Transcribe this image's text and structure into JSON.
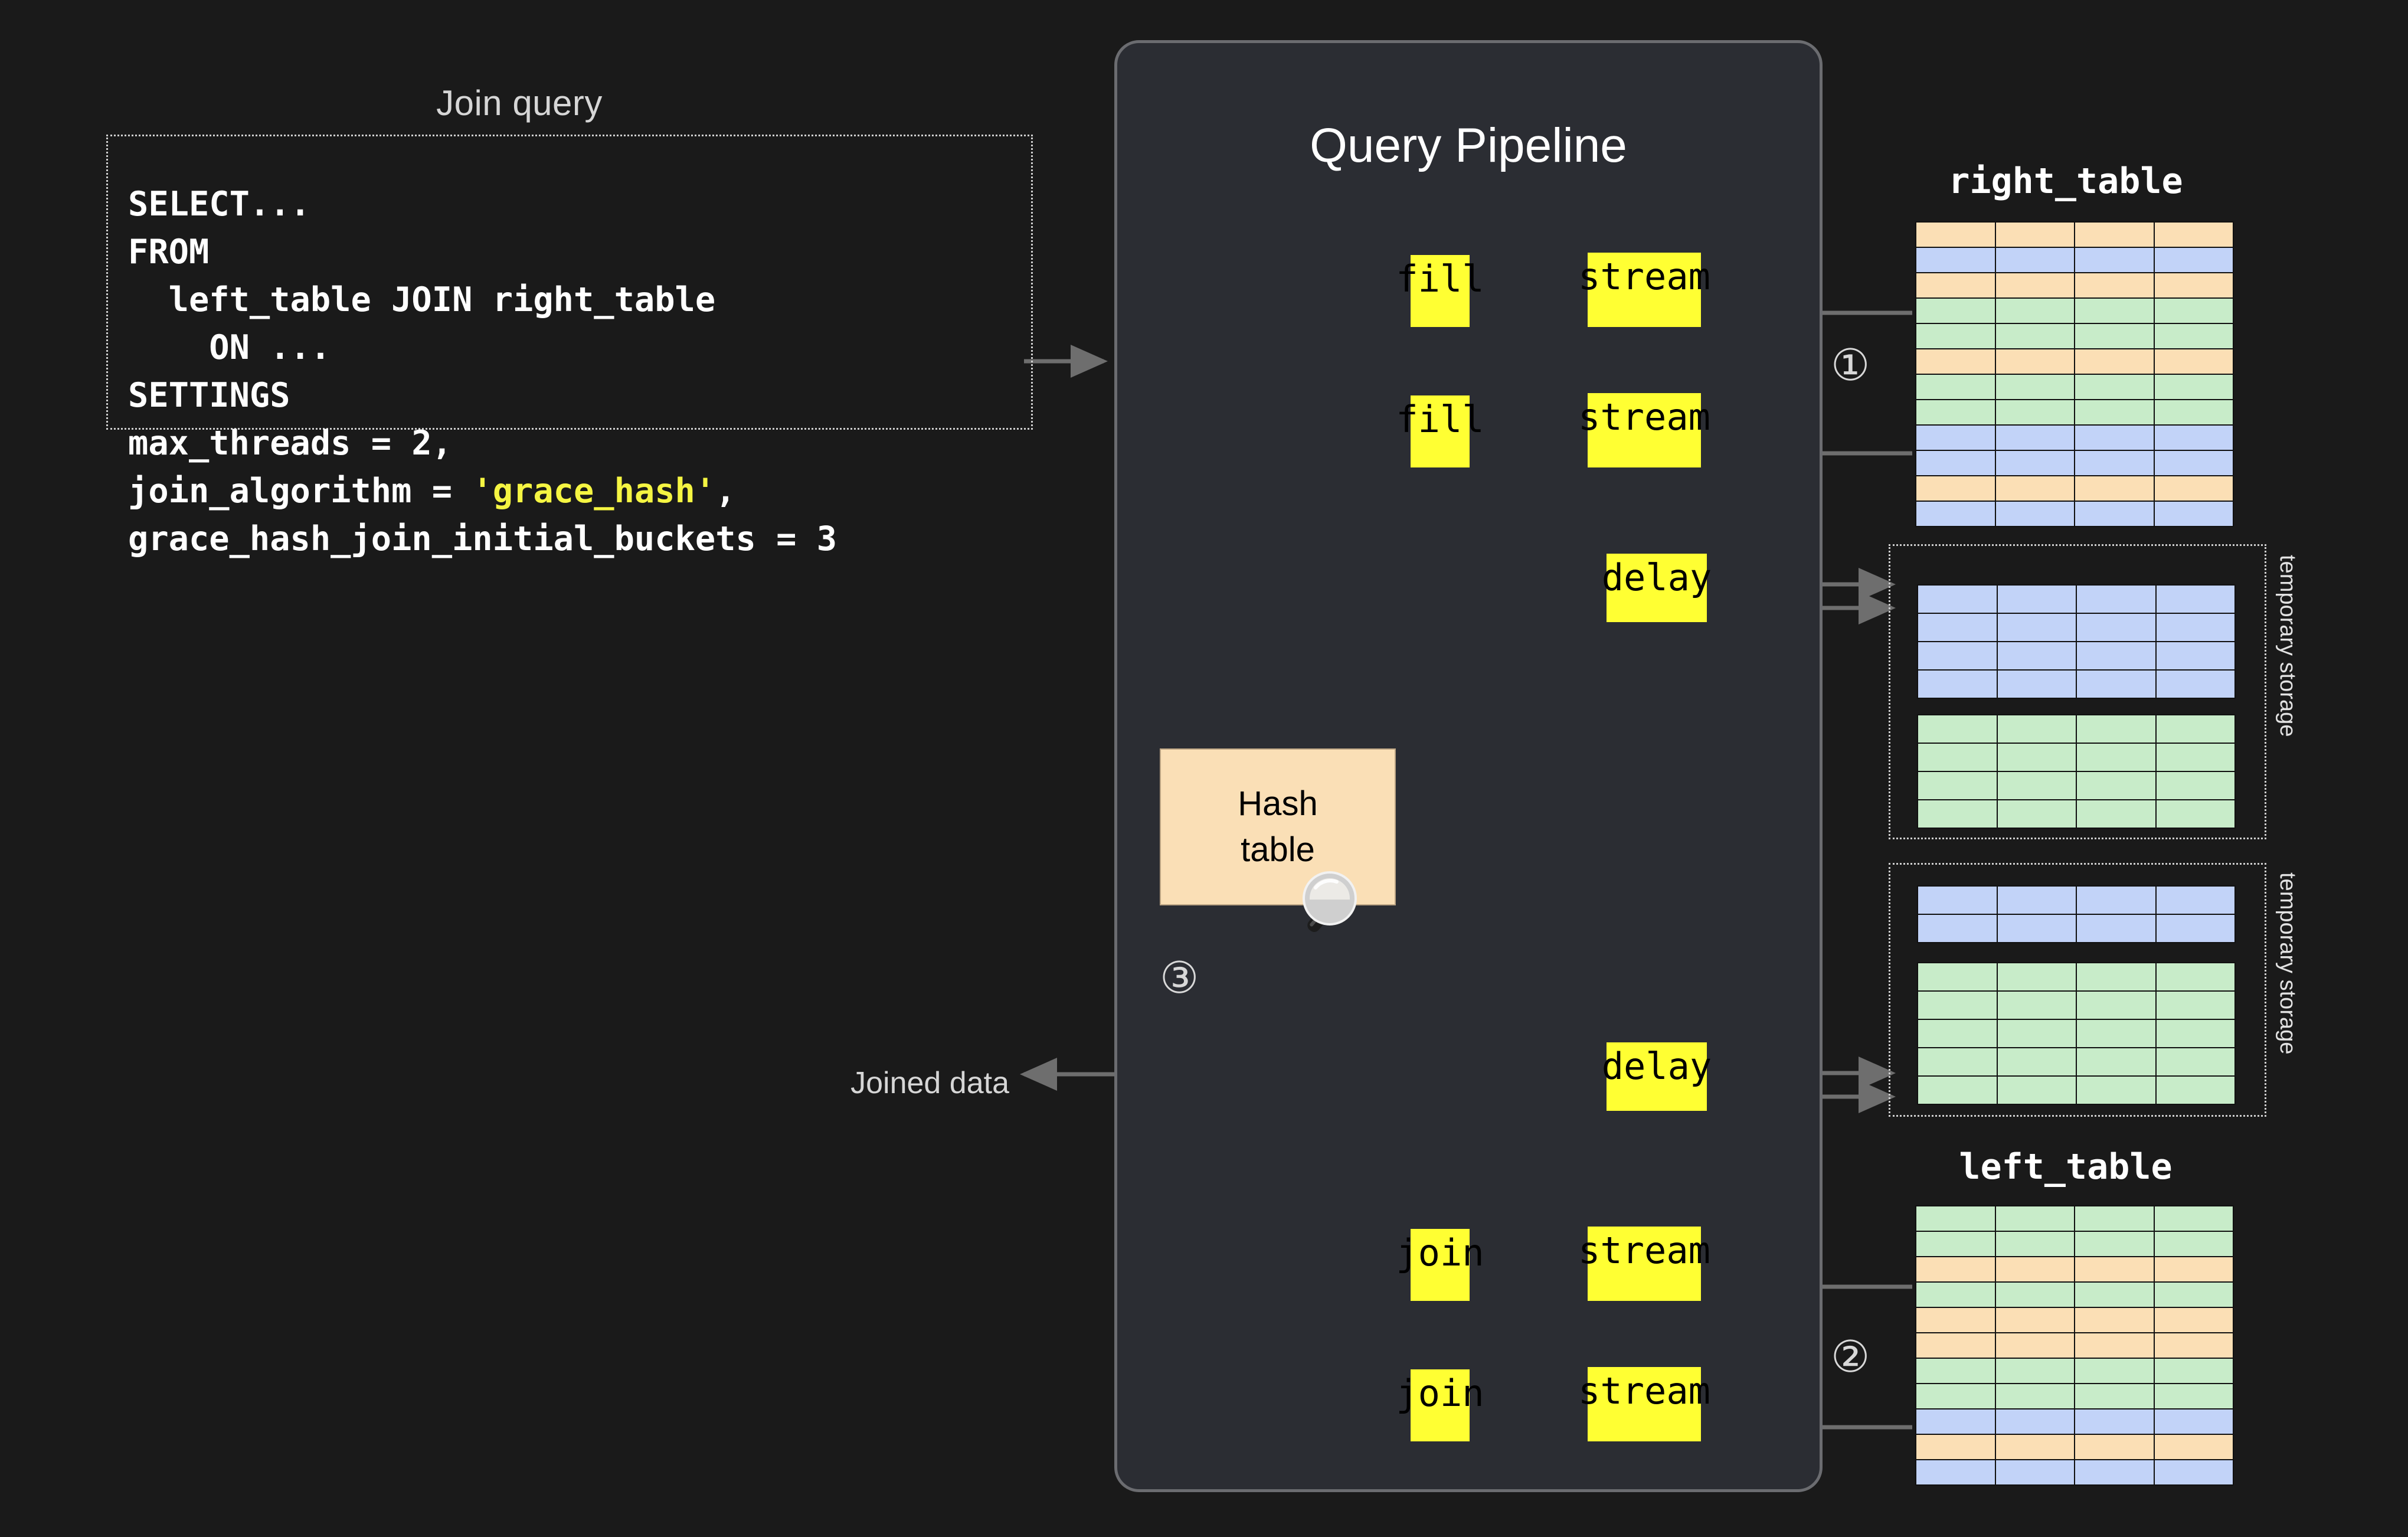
{
  "query": {
    "title": "Join query",
    "lines": [
      {
        "text": "SELECT..."
      },
      {
        "text": "FROM"
      },
      {
        "text": "  left_table JOIN right_table"
      },
      {
        "text": "    ON ..."
      },
      {
        "text": "SETTINGS"
      },
      {
        "text": "max_threads = 2,"
      },
      {
        "text": "join_algorithm = ",
        "highlight": "'grace_hash'",
        "tail": ","
      },
      {
        "text": "grace_hash_join_initial_buckets = 3"
      }
    ],
    "full_text": "SELECT...\nFROM\n  left_table JOIN right_table\n    ON ...\nSETTINGS\nmax_threads = 2,\njoin_algorithm = 'grace_hash',\ngrace_hash_join_initial_buckets = 3",
    "highlight_color": "#f5f542"
  },
  "pipeline": {
    "title": "Query Pipeline",
    "operators": [
      {
        "id": "fill-1",
        "label": "fill"
      },
      {
        "id": "stream-1",
        "label": "stream"
      },
      {
        "id": "fill-2",
        "label": "fill"
      },
      {
        "id": "stream-2",
        "label": "stream"
      },
      {
        "id": "delay-1",
        "label": "delay"
      },
      {
        "id": "delay-2",
        "label": "delay"
      },
      {
        "id": "join-1",
        "label": "join"
      },
      {
        "id": "stream-3",
        "label": "stream"
      },
      {
        "id": "join-2",
        "label": "join"
      },
      {
        "id": "stream-4",
        "label": "stream"
      }
    ],
    "hash_table": {
      "line1": "Hash",
      "line2": "table",
      "icon": "magnifier-icon",
      "color": "#fadfb6"
    },
    "chip_color": "#ffff33",
    "panel_color": "#2b2d33"
  },
  "annotations": {
    "step_1": "①",
    "step_2": "②",
    "step_3": "③",
    "joined_data": "Joined data"
  },
  "right_table": {
    "title": "right_table",
    "columns": 4,
    "rows": [
      "orange",
      "blue",
      "orange",
      "green",
      "green",
      "orange",
      "green",
      "green",
      "blue",
      "blue",
      "orange",
      "blue"
    ]
  },
  "left_table": {
    "title": "left_table",
    "columns": 4,
    "rows": [
      "green",
      "green",
      "orange",
      "green",
      "orange",
      "orange",
      "green",
      "green",
      "blue",
      "orange",
      "blue"
    ]
  },
  "temp_storage_1": {
    "label": "temporary storage",
    "blocks": [
      {
        "color": "blue",
        "rows": 4,
        "columns": 4
      },
      {
        "color": "green",
        "rows": 4,
        "columns": 4
      }
    ]
  },
  "temp_storage_2": {
    "label": "temporary storage",
    "blocks": [
      {
        "color": "blue",
        "rows": 2,
        "columns": 4
      },
      {
        "color": "green",
        "rows": 5,
        "columns": 4
      }
    ]
  },
  "palette": {
    "background": "#1a1a1a",
    "blue": "#c2d3f8",
    "green": "#c8ecc9",
    "orange": "#fbdfb5",
    "wire": "#6e6e6e",
    "text": "#d6d6d6"
  }
}
